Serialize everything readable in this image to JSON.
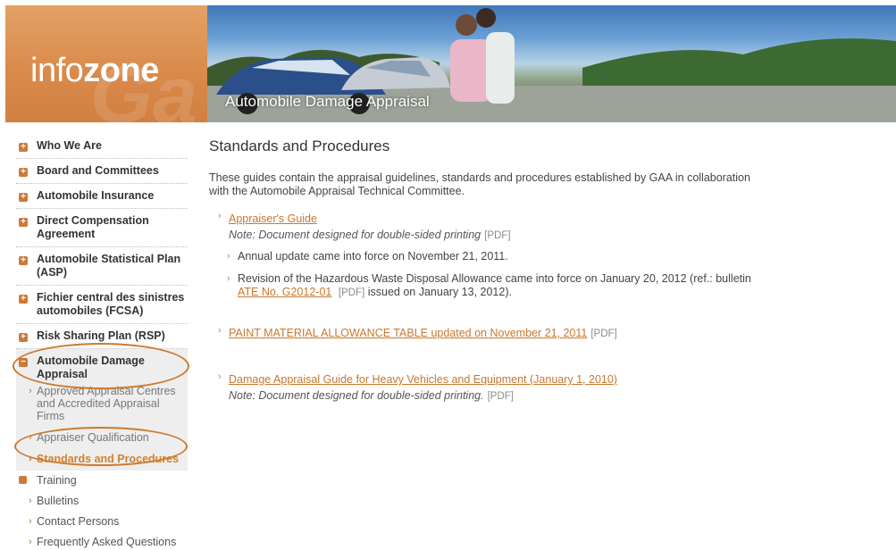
{
  "banner": {
    "logo_prefix": "info",
    "logo_bold": "zone",
    "title": "Automobile Damage Appraisal"
  },
  "sidebar": {
    "items": [
      {
        "label": "Who We Are"
      },
      {
        "label": "Board and Committees"
      },
      {
        "label": "Automobile Insurance"
      },
      {
        "label": "Direct Compensation Agreement"
      },
      {
        "label": "Automobile Statistical Plan (ASP)"
      },
      {
        "label": "Fichier central des sinistres automobiles (FCSA)"
      },
      {
        "label": "Risk Sharing Plan (RSP)"
      }
    ],
    "active_group": {
      "label": "Automobile Damage Appraisal",
      "sub_items": [
        "Approved Appraisal Centres and Accredited Appraisal Firms",
        "Appraiser Qualification",
        "Standards and Procedures"
      ]
    },
    "training": "Training",
    "bulletins": "Bulletins",
    "contact": "Contact Persons",
    "faq": "Frequently Asked Questions"
  },
  "main": {
    "title": "Standards and Procedures",
    "intro": "These guides contain the appraisal guidelines, standards and procedures established by GAA in collaboration with the Automobile Appraisal Technical Committee.",
    "doc1": {
      "link": "Appraiser's Guide",
      "note": "Note: Document designed for double-sided printing",
      "pdf": "[PDF]",
      "sub1": "Annual update came into force on November 21, 2011.",
      "sub2_before": "Revision of the Hazardous Waste Disposal Allowance came into force on January 20, 2012 (ref.: bulletin",
      "sub2_link": "ATE No. G2012-01",
      "sub2_pdf": "[PDF]",
      "sub2_after": "issued on January 13, 2012)."
    },
    "doc2": {
      "link": "PAINT MATERIAL ALLOWANCE TABLE updated on November 21, 2011",
      "pdf": "[PDF]"
    },
    "doc3": {
      "link": "Damage Appraisal Guide for Heavy Vehicles and Equipment (January 1, 2010)",
      "note": "Note: Document designed for double-sided printing.",
      "pdf": "[PDF]"
    }
  },
  "colors": {
    "accent": "#c8772d",
    "logo_bg": "#d9894a",
    "highlight_circle": "#cd7a30"
  },
  "icons": {
    "nav_bullet": "plus-square-icon",
    "sub_bullet": "chevron-right-icon"
  }
}
